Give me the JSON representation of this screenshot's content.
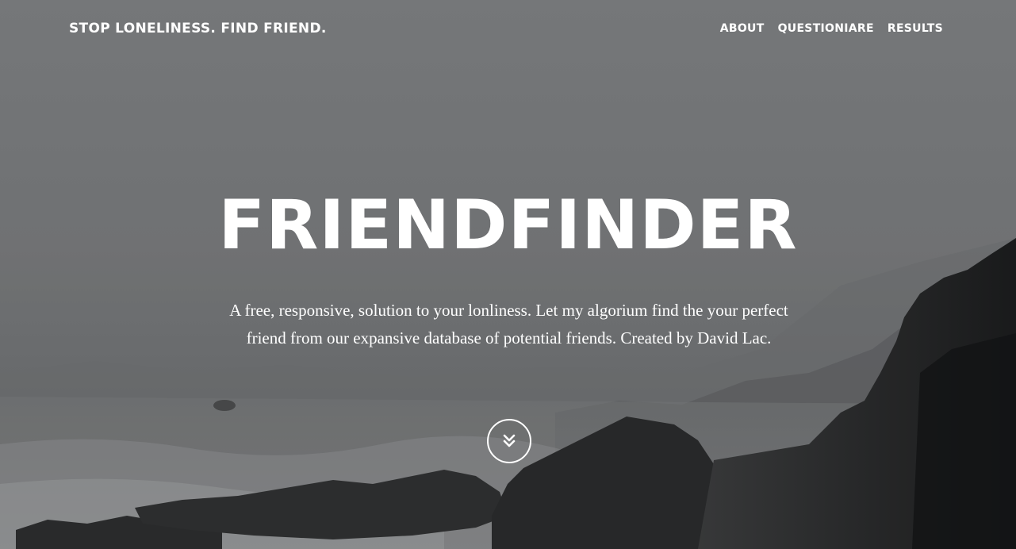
{
  "navbar": {
    "brand": "STOP LONELINESS. FIND FRIEND.",
    "links": [
      {
        "label": "ABOUT"
      },
      {
        "label": "QUESTIONIARE"
      },
      {
        "label": "RESULTS"
      }
    ]
  },
  "hero": {
    "title": "FRIENDFINDER",
    "description": "A free, responsive, solution to your lonliness. Let my algorium find the your perfect friend from our expansive database of potential friends. Created by David Lac.",
    "scroll_icon": "chevron-double-down-icon"
  },
  "colors": {
    "text": "#ffffff",
    "sky": "#7a7c7e",
    "rock": "#1f2021"
  }
}
